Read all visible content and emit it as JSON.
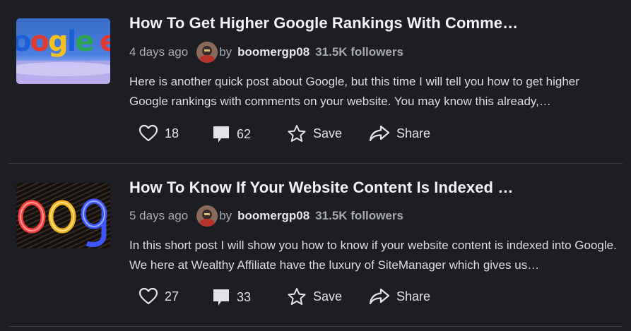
{
  "posts": [
    {
      "title": "How To Get Higher Google Rankings With Comme…",
      "time": "4 days ago",
      "by": "by",
      "author": "boomergp08",
      "followers": "31.5K followers",
      "excerpt": "Here is another quick post about Google, but this time I will tell you how to get higher Google rankings with comments on your website. You may know this already,…",
      "likes": "18",
      "comments": "62",
      "save_label": "Save",
      "share_label": "Share",
      "thumb_text": "oogle"
    },
    {
      "title": "How To Know If Your Website Content Is Indexed …",
      "time": "5 days ago",
      "by": "by",
      "author": "boomergp08",
      "followers": "31.5K followers",
      "excerpt": "In this short post I will show you how to know if your website content is indexed into Google. We here at Wealthy Affiliate have the luxury of SiteManager which gives us…",
      "likes": "27",
      "comments": "33",
      "save_label": "Save",
      "share_label": "Share",
      "thumb_text": "oog"
    }
  ],
  "icons": {
    "like": "heart-icon",
    "comment": "comment-icon",
    "save": "star-icon",
    "share": "share-icon"
  },
  "colors": {
    "background": "#1c1e24",
    "title": "#f2f2f4",
    "muted": "#a7a9b0",
    "divider": "#3a3d45"
  }
}
